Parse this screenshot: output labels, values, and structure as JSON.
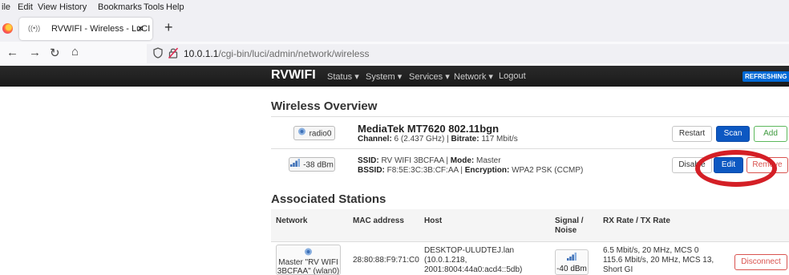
{
  "browser": {
    "menu": [
      "ile",
      "Edit",
      "View",
      "History",
      "Bookmarks",
      "Tools",
      "Help"
    ],
    "tab_title": "RVWIFI - Wireless - LuCI",
    "tab_close": "×",
    "new_tab": "+",
    "url_host": "10.0.1.1",
    "url_path": "/cgi-bin/luci/admin/network/wireless"
  },
  "luci": {
    "brand": "RVWIFI",
    "menu": [
      "Status ▾",
      "System ▾",
      "Services ▾",
      "Network ▾",
      "Logout"
    ],
    "refresh": "REFRESHING"
  },
  "wireless": {
    "heading": "Wireless Overview",
    "device": {
      "badge": "radio0",
      "title": "MediaTek MT7620 802.11bgn",
      "channel_label": "Channel:",
      "channel_value": " 6 (2.437 GHz) | ",
      "bitrate_label": "Bitrate:",
      "bitrate_value": " 117 Mbit/s",
      "buttons": {
        "restart": "Restart",
        "scan": "Scan",
        "add": "Add"
      }
    },
    "network": {
      "badge": "-38 dBm",
      "ssid_label": "SSID:",
      "ssid_value": " RV WIFI 3BCFAA | ",
      "mode_label": "Mode:",
      "mode_value": " Master",
      "bssid_label": "BSSID:",
      "bssid_value": " F8:5E:3C:3B:CF:AA | ",
      "enc_label": "Encryption:",
      "enc_value": " WPA2 PSK (CCMP)",
      "buttons": {
        "disable": "Disable",
        "edit": "Edit",
        "remove": "Remove"
      }
    }
  },
  "stations": {
    "heading": "Associated Stations",
    "columns": [
      "Network",
      "MAC address",
      "Host",
      "Signal / Noise",
      "RX Rate / TX Rate"
    ],
    "rows": [
      {
        "network_lines": [
          "Master \"RV WIFI",
          "3BCFAA\" (wlan0)"
        ],
        "mac": "28:80:88:F9:71:C0",
        "host_lines": [
          "DESKTOP-ULUDTEJ.lan",
          "(10.0.1.218,",
          "2001:8004:44a0:acd4::5db)"
        ],
        "signal": "-40 dBm",
        "rate_lines": [
          "6.5 Mbit/s, 20 MHz, MCS 0",
          "115.6 Mbit/s, 20 MHz, MCS 13,",
          "Short GI"
        ],
        "action": "Disconnect"
      }
    ]
  },
  "colors": {
    "accent": "#0d58c2",
    "danger": "#d9534f",
    "success": "#5cb85c",
    "annotation": "#d41f26"
  }
}
